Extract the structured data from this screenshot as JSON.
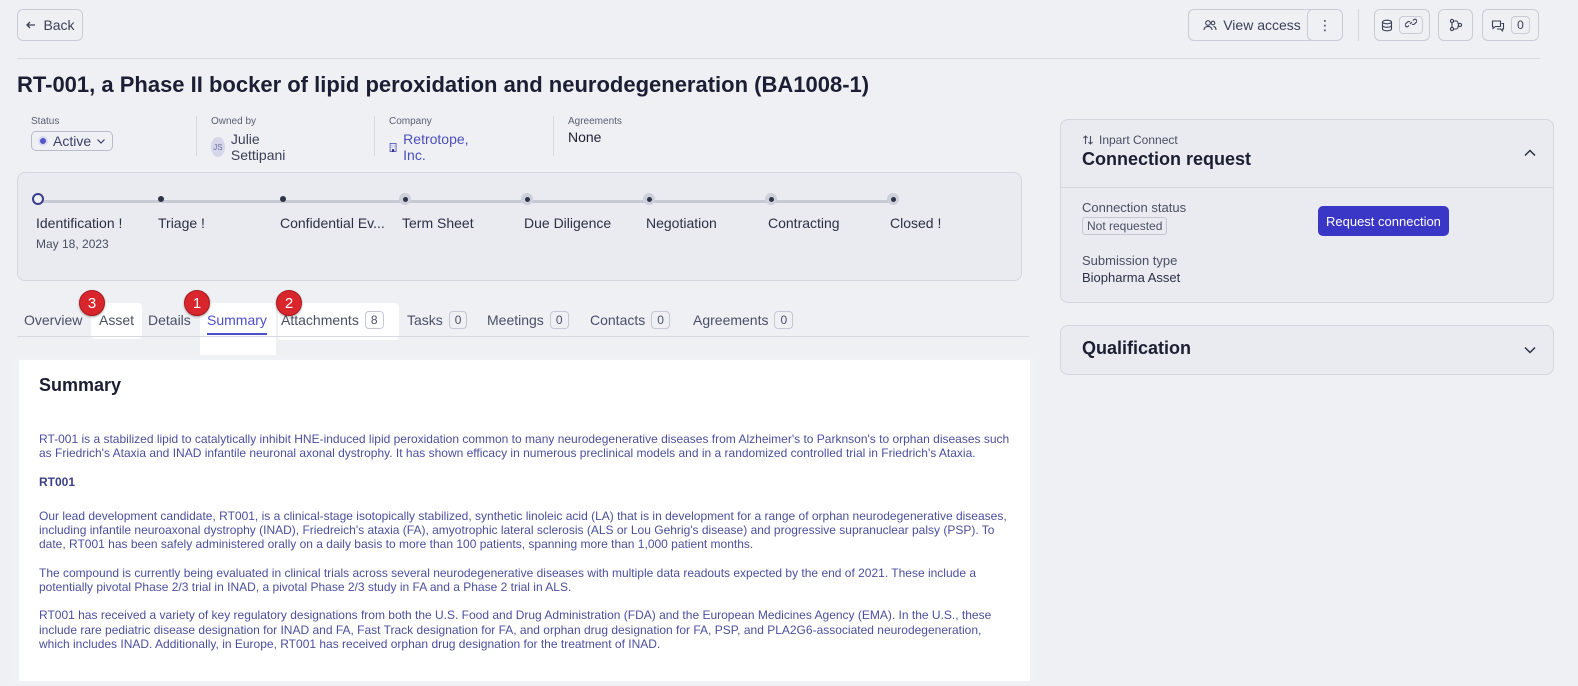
{
  "topbar": {
    "back_label": "Back",
    "view_access_label": "View access",
    "more_label": "⋮",
    "comments_count": "0"
  },
  "page": {
    "title": "RT-001, a Phase II bocker of lipid peroxidation and neurodegeneration (BA1008-1)"
  },
  "meta": {
    "status_label": "Status",
    "status_value": "Active",
    "owner_label": "Owned by",
    "owner_initials": "JS",
    "owner_name": "Julie Settipani",
    "company_label": "Company",
    "company_name": "Retrotope, Inc.",
    "agreements_label": "Agreements",
    "agreements_value": "None"
  },
  "pipeline": {
    "stages": [
      {
        "label": "Identification !",
        "date": "May 18, 2023"
      },
      {
        "label": "Triage !"
      },
      {
        "label": "Confidential Ev..."
      },
      {
        "label": "Term Sheet"
      },
      {
        "label": "Due Diligence"
      },
      {
        "label": "Negotiation"
      },
      {
        "label": "Contracting"
      },
      {
        "label": "Closed !"
      }
    ]
  },
  "tabs": [
    {
      "label": "Overview"
    },
    {
      "label": "Asset"
    },
    {
      "label": "Details"
    },
    {
      "label": "Summary"
    },
    {
      "label": "Attachments",
      "count": "8"
    },
    {
      "label": "Tasks",
      "count": "0"
    },
    {
      "label": "Meetings",
      "count": "0"
    },
    {
      "label": "Contacts",
      "count": "0"
    },
    {
      "label": "Agreements",
      "count": "0"
    }
  ],
  "markers": [
    "1",
    "2",
    "3"
  ],
  "summary": {
    "title": "Summary",
    "p1": "RT-001 is a stabilized lipid to catalytically inhibit HNE-induced lipid peroxidation common to many neurodegenerative diseases from Alzheimer's to Parknson's to orphan diseases such as Friedrich's Ataxia and INAD infantile neuronal axonal dystrophy. It has shown efficacy in numerous preclinical models and in a randomized controlled trial in Friedrich's Ataxia.",
    "heading": "RT001",
    "p2": "Our lead development candidate, RT001, is a clinical-stage isotopically stabilized, synthetic linoleic acid (LA) that is in development for a range of orphan neurodegenerative diseases, including infantile neuroaxonal dystrophy (INAD), Friedreich's ataxia (FA), amyotrophic lateral sclerosis (ALS or Lou Gehrig's disease) and progressive supranuclear palsy (PSP). To date, RT001 has been safely administered orally on a daily basis to more than 100 patients, spanning more than 1,000 patient months.",
    "p3": "The compound is currently being evaluated in clinical trials across several neurodegenerative diseases with multiple data readouts expected by the end of 2021. These include a potentially pivotal Phase 2/3 trial in INAD, a pivotal Phase 2/3 study in FA and a Phase 2 trial in ALS.",
    "p4": "RT001 has received a variety of key regulatory designations from both the U.S. Food and Drug Administration (FDA) and the European Medicines Agency (EMA). In the U.S., these include rare pediatric disease designation for INAD and FA, Fast Track designation for FA, and orphan drug designation for FA, PSP, and PLA2G6-associated neurodegeneration, which includes INAD. Additionally, in Europe, RT001 has received orphan drug designation for the treatment of INAD."
  },
  "connection": {
    "sub_label": "Inpart Connect",
    "title": "Connection request",
    "status_label": "Connection status",
    "status_value": "Not requested",
    "request_button": "Request connection",
    "submission_label": "Submission type",
    "submission_value": "Biopharma Asset"
  },
  "qualification": {
    "title": "Qualification"
  }
}
